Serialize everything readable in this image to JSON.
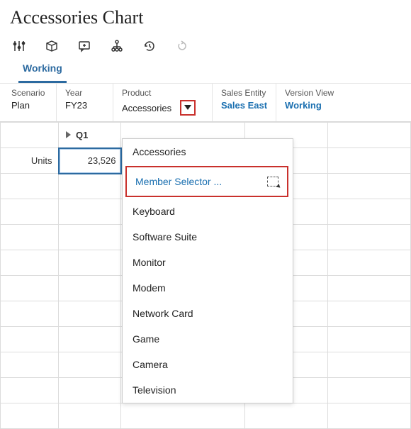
{
  "title": "Accessories Chart",
  "toolbar": {
    "icons": [
      "sliders-icon",
      "cube-icon",
      "comment-icon",
      "hierarchy-icon",
      "history-icon",
      "redo-icon"
    ]
  },
  "tabs": {
    "active": "Working"
  },
  "pov": {
    "scenario": {
      "label": "Scenario",
      "value": "Plan"
    },
    "year": {
      "label": "Year",
      "value": "FY23"
    },
    "product": {
      "label": "Product",
      "value": "Accessories"
    },
    "salesEntity": {
      "label": "Sales Entity",
      "value": "Sales East"
    },
    "versionView": {
      "label": "Version View",
      "value": "Working"
    }
  },
  "grid": {
    "colHeader": "Q1",
    "rowHeader": "Units",
    "dataCell": "23,526",
    "emptyRowCount": 10
  },
  "dropdown": {
    "memberSelectorLabel": "Member Selector ...",
    "items": [
      "Accessories",
      "Keyboard",
      "Software Suite",
      "Monitor",
      "Modem",
      "Network Card",
      "Game",
      "Camera",
      "Television"
    ]
  }
}
